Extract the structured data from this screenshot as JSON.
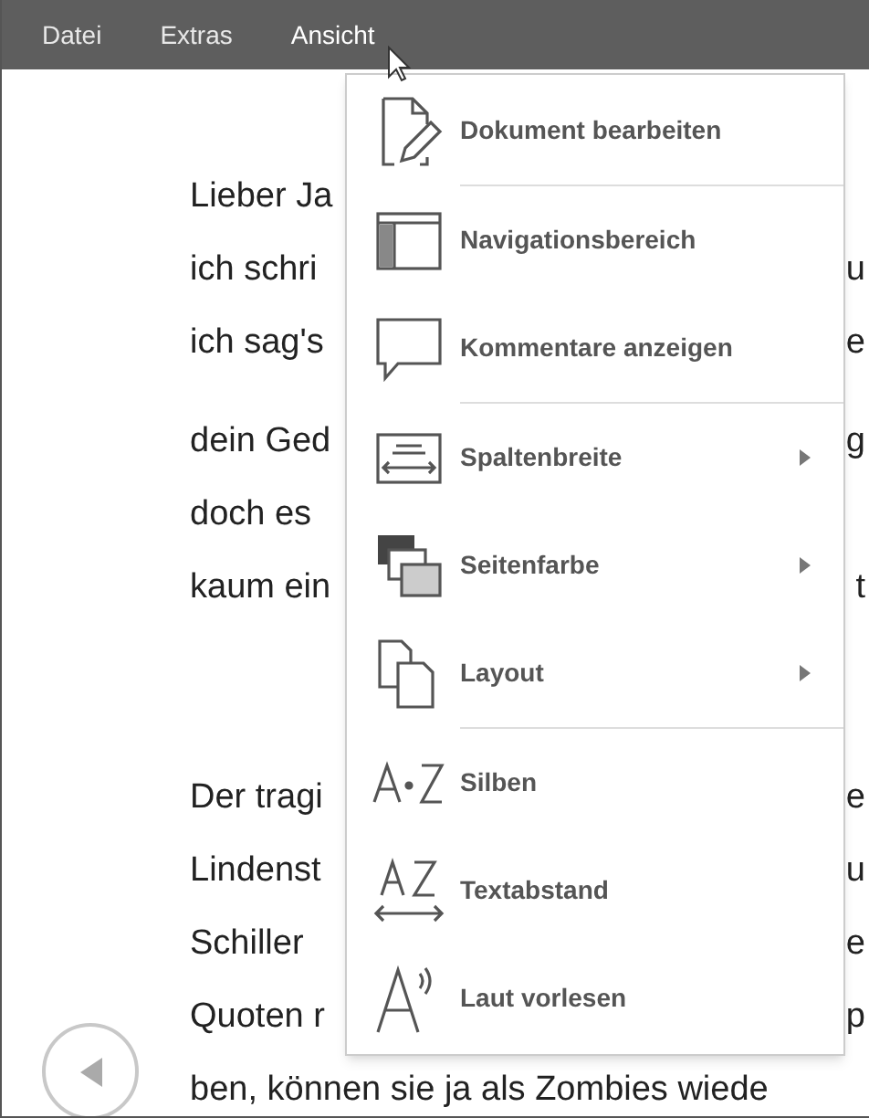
{
  "menu_bar": [
    {
      "label": "Datei",
      "selected": false
    },
    {
      "label": "Extras",
      "selected": false
    },
    {
      "label": "Ansicht",
      "selected": true
    }
  ],
  "document": {
    "paragraphs": [
      {
        "lines": [
          {
            "left": "Lieber Ja"
          },
          {
            "left": "ich schri",
            "right": "u"
          },
          {
            "left": "ich sag's",
            "right": "e"
          }
        ]
      },
      {
        "lines": [
          {
            "left": "dein Ged",
            "right": "g"
          },
          {
            "left": "doch es"
          },
          {
            "left": "kaum ein",
            "right": "t"
          }
        ]
      },
      {
        "lines": [
          {
            "left": "Der tragi",
            "right": "e"
          },
          {
            "left": "Lindenst",
            "right": "u"
          },
          {
            "left": "Schiller",
            "right": "e"
          },
          {
            "left": "Quoten r",
            "right": "p"
          },
          {
            "left": "ben, können sie ja als Zombies wiede"
          }
        ]
      }
    ]
  },
  "view_menu": {
    "items": [
      {
        "label": "Dokument bearbeiten",
        "submenu": false,
        "separator_after": true
      },
      {
        "label": "Navigationsbereich",
        "submenu": false,
        "separator_after": false
      },
      {
        "label": "Kommentare anzeigen",
        "submenu": false,
        "separator_after": true
      },
      {
        "label": "Spaltenbreite",
        "submenu": true,
        "separator_after": false
      },
      {
        "label": "Seitenfarbe",
        "submenu": true,
        "separator_after": false
      },
      {
        "label": "Layout",
        "submenu": true,
        "separator_after": true
      },
      {
        "label": "Silben",
        "submenu": false,
        "separator_after": false
      },
      {
        "label": "Textabstand",
        "submenu": false,
        "separator_after": false
      },
      {
        "label": "Laut vorlesen",
        "submenu": false,
        "separator_after": false
      }
    ]
  }
}
